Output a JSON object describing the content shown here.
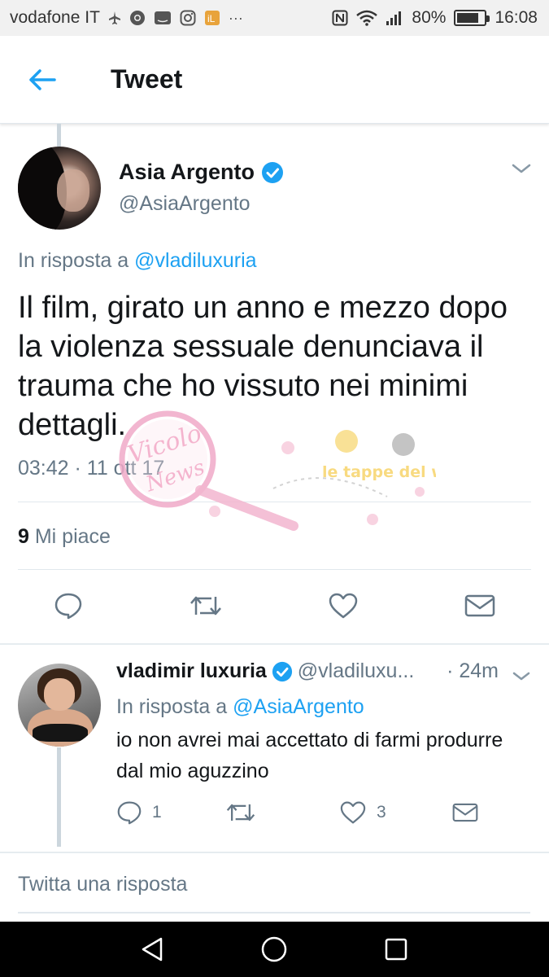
{
  "status_bar": {
    "carrier": "vodafone IT",
    "battery": "80%",
    "battery_level": 0.8,
    "time": "16:08",
    "icons": [
      "flight-off-icon",
      "chrome-icon",
      "amazon-icon",
      "instagram-icon",
      "app-icon",
      "more-icon",
      "nfc-icon",
      "wifi-icon",
      "signal-icon",
      "battery-icon"
    ]
  },
  "header": {
    "back_icon": "arrow-left-icon",
    "title": "Tweet"
  },
  "tweet": {
    "display_name": "Asia Argento",
    "handle": "@AsiaArgento",
    "reply_prefix": "In risposta a",
    "reply_mention": "@vladiluxuria",
    "text": "Il film, girato un anno e mezzo dopo la violenza sessuale denunciava il trauma che ho vissuto nei minimi dettagli.",
    "timestamp": "03:42 · 11 ott 17",
    "likes_count": "9",
    "likes_label": "Mi piace"
  },
  "watermark": {
    "brand": "Vicolo News",
    "tagline": "le tappe del web"
  },
  "reply": {
    "display_name": "vladimir luxuria",
    "handle": "@vladiluxu...",
    "time": "· 24m",
    "reply_prefix": "In risposta a",
    "reply_mention": "@AsiaArgento",
    "text": "io non avrei mai accettato di farmi produrre dal mio aguzzino",
    "reply_count": "1",
    "retweet_count": "",
    "like_count": "3"
  },
  "compose": {
    "placeholder": "Twitta una risposta"
  },
  "colors": {
    "accent": "#1da1f2",
    "secondary_text": "#657786",
    "primary_text": "#14171a",
    "divider": "#e1e8ed"
  }
}
